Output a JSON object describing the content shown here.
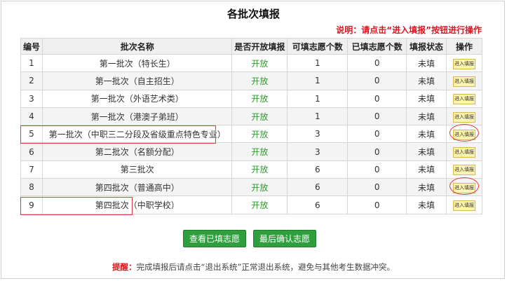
{
  "title": "各批次填报",
  "note": "说明：请点击“进入填报”按钮进行操作",
  "table": {
    "headers": [
      "编号",
      "批次名称",
      "是否开放填报",
      "可填志愿个数",
      "已填志愿个数",
      "填报状态",
      "操作"
    ],
    "rows": [
      {
        "no": "1",
        "name": "第一批次（特长生）",
        "open": "开放",
        "allowed": "1",
        "filled": "0",
        "status": "未填",
        "action": "进入填报"
      },
      {
        "no": "2",
        "name": "第一批次（自主招生）",
        "open": "开放",
        "allowed": "1",
        "filled": "0",
        "status": "未填",
        "action": "进入填报"
      },
      {
        "no": "3",
        "name": "第一批次（外语艺术类）",
        "open": "开放",
        "allowed": "1",
        "filled": "0",
        "status": "未填",
        "action": "进入填报"
      },
      {
        "no": "4",
        "name": "第一批次（港澳子弟班）",
        "open": "开放",
        "allowed": "1",
        "filled": "0",
        "status": "未填",
        "action": "进入填报"
      },
      {
        "no": "5",
        "name": "第一批次（中职三二分段及省级重点特色专业）",
        "open": "开放",
        "allowed": "3",
        "filled": "0",
        "status": "未填",
        "action": "进入填报"
      },
      {
        "no": "6",
        "name": "第二批次（名额分配）",
        "open": "开放",
        "allowed": "3",
        "filled": "0",
        "status": "未填",
        "action": "进入填报"
      },
      {
        "no": "7",
        "name": "第三批次",
        "open": "开放",
        "allowed": "6",
        "filled": "0",
        "status": "未填",
        "action": "进入填报"
      },
      {
        "no": "8",
        "name": "第四批次（普通高中）",
        "open": "开放",
        "allowed": "6",
        "filled": "0",
        "status": "未填",
        "action": "进入填报"
      },
      {
        "no": "9",
        "name": "第四批次（中职学校）",
        "open": "开放",
        "allowed": "6",
        "filled": "0",
        "status": "未填",
        "action": "进入填报"
      }
    ]
  },
  "buttons": {
    "view_filled": "查看已填志愿",
    "final_confirm": "最后确认志愿"
  },
  "tip": {
    "label": "提醒：",
    "text": "完成填报后请点击“退出系统”正常退出系统，避免与其他考生数据冲突。"
  },
  "colors": {
    "accent_red": "#e53935",
    "open_green": "#2e9b2e",
    "button_green": "#2f9e3c",
    "enter_button_bg": "#fdf4b0"
  }
}
